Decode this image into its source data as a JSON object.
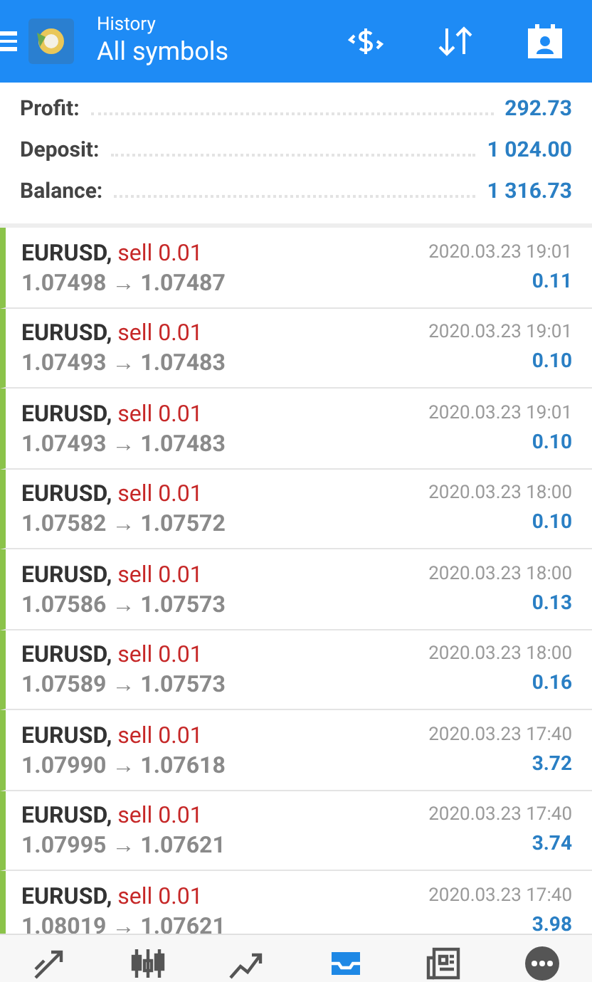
{
  "header": {
    "subtitle": "History",
    "title": "All symbols"
  },
  "summary": [
    {
      "label": "Profit:",
      "value": "292.73"
    },
    {
      "label": "Deposit:",
      "value": "1 024.00"
    },
    {
      "label": "Balance:",
      "value": "1 316.73"
    }
  ],
  "deals": [
    {
      "symbol": "EURUSD,",
      "action": "sell 0.01",
      "prices": "1.07498 → 1.07487",
      "time": "2020.03.23 19:01",
      "profit": "0.11"
    },
    {
      "symbol": "EURUSD,",
      "action": "sell 0.01",
      "prices": "1.07493 → 1.07483",
      "time": "2020.03.23 19:01",
      "profit": "0.10"
    },
    {
      "symbol": "EURUSD,",
      "action": "sell 0.01",
      "prices": "1.07493 → 1.07483",
      "time": "2020.03.23 19:01",
      "profit": "0.10"
    },
    {
      "symbol": "EURUSD,",
      "action": "sell 0.01",
      "prices": "1.07582 → 1.07572",
      "time": "2020.03.23 18:00",
      "profit": "0.10"
    },
    {
      "symbol": "EURUSD,",
      "action": "sell 0.01",
      "prices": "1.07586 → 1.07573",
      "time": "2020.03.23 18:00",
      "profit": "0.13"
    },
    {
      "symbol": "EURUSD,",
      "action": "sell 0.01",
      "prices": "1.07589 → 1.07573",
      "time": "2020.03.23 18:00",
      "profit": "0.16"
    },
    {
      "symbol": "EURUSD,",
      "action": "sell 0.01",
      "prices": "1.07990 → 1.07618",
      "time": "2020.03.23 17:40",
      "profit": "3.72"
    },
    {
      "symbol": "EURUSD,",
      "action": "sell 0.01",
      "prices": "1.07995 → 1.07621",
      "time": "2020.03.23 17:40",
      "profit": "3.74"
    },
    {
      "symbol": "EURUSD,",
      "action": "sell 0.01",
      "prices": "1.08019 → 1.07621",
      "time": "2020.03.23 17:40",
      "profit": "3.98"
    }
  ],
  "nav": [
    {
      "kind": "quotes",
      "selected": false
    },
    {
      "kind": "chart",
      "selected": false
    },
    {
      "kind": "trade",
      "selected": false
    },
    {
      "kind": "history",
      "selected": true
    },
    {
      "kind": "news",
      "selected": false
    },
    {
      "kind": "more",
      "selected": false
    }
  ]
}
